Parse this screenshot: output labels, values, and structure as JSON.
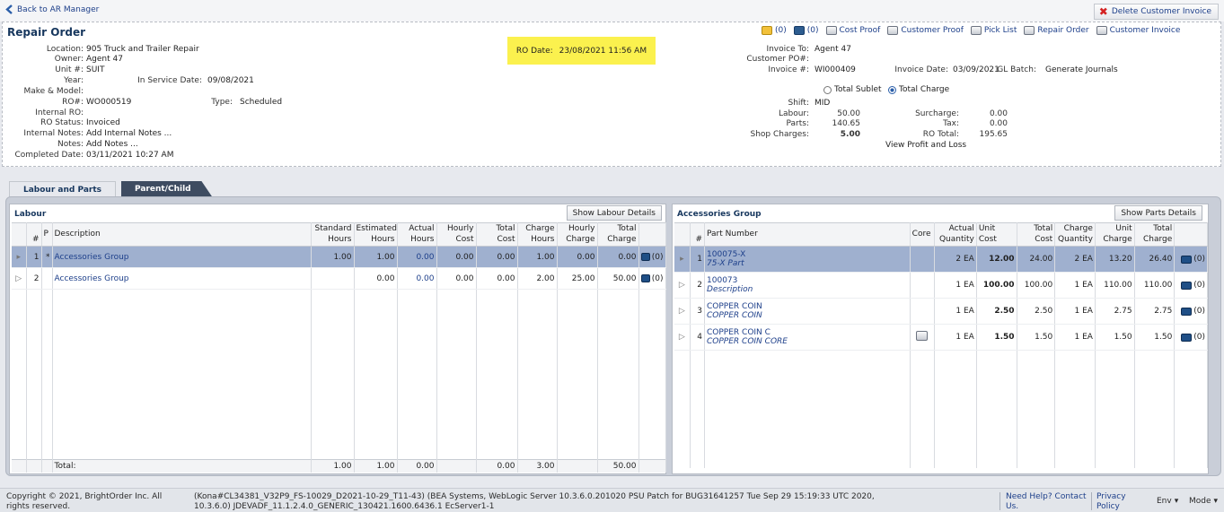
{
  "topbar": {
    "back_label": "Back to AR Manager",
    "delete_label": "Delete Customer Invoice"
  },
  "header": {
    "title": "Repair Order",
    "ro_date_label": "RO Date:",
    "ro_date_value": "23/08/2021 11:56 AM",
    "left_fields": {
      "location": {
        "label": "Location:",
        "value": "905 Truck and Trailer Repair"
      },
      "owner": {
        "label": "Owner:",
        "value": "Agent 47"
      },
      "unit": {
        "label": "Unit #:",
        "value": "SUIT"
      },
      "year": {
        "label": "Year:",
        "value": ""
      },
      "in_service": {
        "label": "In Service Date:",
        "value": "09/08/2021"
      },
      "make_model": {
        "label": "Make & Model:",
        "value": ""
      },
      "ro_num": {
        "label": "RO#:",
        "value": "WO000519"
      },
      "type": {
        "label": "Type:",
        "value": "Scheduled"
      },
      "internal_ro": {
        "label": "Internal RO:",
        "value": ""
      },
      "ro_status": {
        "label": "RO Status:",
        "value": "Invoiced"
      },
      "internal_notes": {
        "label": "Internal Notes:",
        "value": "Add Internal Notes ..."
      },
      "notes": {
        "label": "Notes:",
        "value": "Add Notes ..."
      },
      "completed": {
        "label": "Completed Date:",
        "value": "03/11/2021 10:27 AM"
      }
    },
    "actions": {
      "mail_count": "(0)",
      "cam_count": "(0)",
      "cost_proof": "Cost Proof",
      "customer_proof": "Customer Proof",
      "pick_list": "Pick List",
      "repair_order": "Repair Order",
      "customer_invoice": "Customer Invoice"
    },
    "right_fields": {
      "invoice_to": {
        "label": "Invoice To:",
        "value": "Agent 47"
      },
      "customer_po": {
        "label": "Customer PO#:",
        "value": ""
      },
      "invoice_num": {
        "label": "Invoice #:",
        "value": "WI000409"
      },
      "invoice_date": {
        "label": "Invoice Date:",
        "value": "03/09/2021"
      },
      "gl_batch": {
        "label": "GL Batch:",
        "value": "Generate Journals"
      },
      "total_sublet": "Total Sublet",
      "total_charge": "Total Charge",
      "shift": {
        "label": "Shift:",
        "value": "MID"
      },
      "labour": {
        "label": "Labour:",
        "value": "50.00"
      },
      "parts": {
        "label": "Parts:",
        "value": "140.65"
      },
      "shop_charges": {
        "label": "Shop Charges:",
        "value": "5.00"
      },
      "surcharge": {
        "label": "Surcharge:",
        "value": "0.00"
      },
      "tax": {
        "label": "Tax:",
        "value": "0.00"
      },
      "ro_total": {
        "label": "RO Total:",
        "value": "195.65"
      },
      "profit_loss": "View Profit and Loss"
    }
  },
  "tabs": {
    "labour_parts": "Labour and Parts",
    "parent_child": "Parent/Child"
  },
  "labour": {
    "title": "Labour",
    "button": "Show Labour Details",
    "headers": [
      "#",
      "P",
      "Description",
      "Standard Hours",
      "Estimated Hours",
      "Actual Hours",
      "Hourly Cost",
      "Total Cost",
      "Charge Hours",
      "Hourly Charge",
      "Total Charge"
    ],
    "rows": [
      {
        "num": "1",
        "p": "*",
        "desc": "Accessories Group",
        "std": "1.00",
        "est": "1.00",
        "act": "0.00",
        "hcost": "0.00",
        "tcost": "0.00",
        "chrs": "1.00",
        "hchg": "0.00",
        "tchg": "0.00",
        "count": "(0)"
      },
      {
        "num": "2",
        "p": "",
        "desc": "Accessories Group",
        "std": "",
        "est": "0.00",
        "act": "0.00",
        "hcost": "0.00",
        "tcost": "0.00",
        "chrs": "2.00",
        "hchg": "25.00",
        "tchg": "50.00",
        "count": "(0)"
      }
    ],
    "total": {
      "label": "Total:",
      "std": "1.00",
      "est": "1.00",
      "act": "0.00",
      "tcost": "0.00",
      "chrs": "3.00",
      "tchg": "50.00"
    }
  },
  "accessories": {
    "title": "Accessories Group",
    "button": "Show Parts Details",
    "headers": [
      "#",
      "Part Number",
      "Core",
      "Actual Quantity",
      "Unit Cost",
      "Total Cost",
      "Charge Quantity",
      "Unit Charge",
      "Total Charge"
    ],
    "rows": [
      {
        "num": "1",
        "part": "100075-X",
        "sub": "75-X Part",
        "core": "",
        "aqty": "2 EA",
        "ucost": "12.00",
        "tcost": "24.00",
        "cqty": "2 EA",
        "uchg": "13.20",
        "tchg": "26.40",
        "count": "(0)"
      },
      {
        "num": "2",
        "part": "100073",
        "sub": "Description",
        "core": "",
        "aqty": "1 EA",
        "ucost": "100.00",
        "tcost": "100.00",
        "cqty": "1 EA",
        "uchg": "110.00",
        "tchg": "110.00",
        "count": "(0)"
      },
      {
        "num": "3",
        "part": "COPPER COIN",
        "sub": "COPPER COIN",
        "core": "",
        "aqty": "1 EA",
        "ucost": "2.50",
        "tcost": "2.50",
        "cqty": "1 EA",
        "uchg": "2.75",
        "tchg": "2.75",
        "count": "(0)"
      },
      {
        "num": "4",
        "part": "COPPER COIN C",
        "sub": "COPPER COIN CORE",
        "core": "printer-icon",
        "aqty": "1 EA",
        "ucost": "1.50",
        "tcost": "1.50",
        "cqty": "1 EA",
        "uchg": "1.50",
        "tchg": "1.50",
        "count": "(0)"
      }
    ]
  },
  "footer": {
    "copyright": "Copyright © 2021, BrightOrder Inc. All rights reserved.",
    "build": "(Kona#CL34381_V32P9_FS-10029_D2021-10-29_T11-43) (BEA Systems, WebLogic Server 10.3.6.0.201020 PSU Patch for BUG31641257 Tue Sep 29 15:19:33 UTC 2020, 10.3.6.0) JDEVADF_11.1.2.4.0_GENERIC_130421.1600.6436.1 EcServer1-1",
    "help": "Need Help? Contact Us.",
    "privacy": "Privacy Policy",
    "env": "Env",
    "mode": "Mode"
  }
}
